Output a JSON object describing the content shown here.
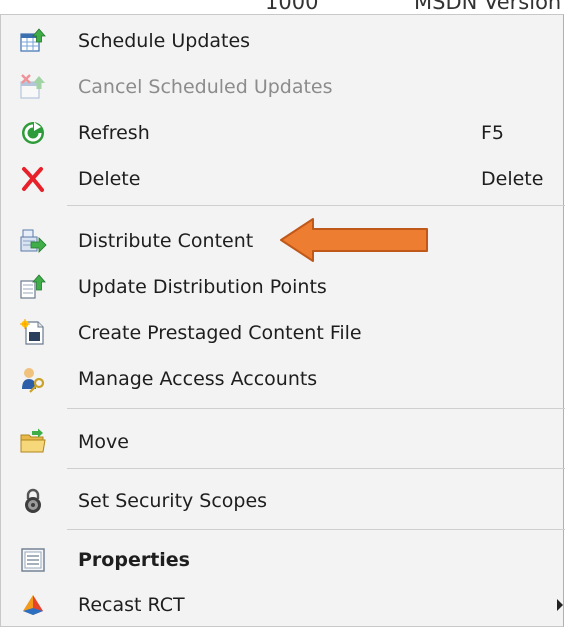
{
  "background": {
    "text_left": "1000",
    "text_right": "MSDN Version"
  },
  "menu": {
    "items": [
      {
        "label": "Schedule Updates",
        "shortcut": "",
        "icon": "schedule-updates-icon",
        "disabled": false
      },
      {
        "label": "Cancel Scheduled Updates",
        "shortcut": "",
        "icon": "cancel-schedule-icon",
        "disabled": true
      },
      {
        "label": "Refresh",
        "shortcut": "F5",
        "icon": "refresh-icon",
        "disabled": false
      },
      {
        "label": "Delete",
        "shortcut": "Delete",
        "icon": "delete-icon",
        "disabled": false
      },
      {
        "label": "Distribute Content",
        "shortcut": "",
        "icon": "distribute-content-icon",
        "disabled": false
      },
      {
        "label": "Update Distribution Points",
        "shortcut": "",
        "icon": "update-distribution-icon",
        "disabled": false
      },
      {
        "label": "Create Prestaged Content File",
        "shortcut": "",
        "icon": "prestaged-file-icon",
        "disabled": false
      },
      {
        "label": "Manage Access Accounts",
        "shortcut": "",
        "icon": "access-accounts-icon",
        "disabled": false
      },
      {
        "label": "Move",
        "shortcut": "",
        "icon": "folder-move-icon",
        "disabled": false
      },
      {
        "label": "Set Security Scopes",
        "shortcut": "",
        "icon": "lock-icon",
        "disabled": false
      },
      {
        "label": "Properties",
        "shortcut": "",
        "icon": "properties-icon",
        "disabled": false,
        "bold": true
      },
      {
        "label": "Recast RCT",
        "shortcut": "",
        "icon": "recast-icon",
        "disabled": false,
        "submenu": true
      }
    ]
  },
  "colors": {
    "annotation_arrow": "#ed7d31",
    "annotation_arrow_border": "#c0581a",
    "delete_red": "#e8202a",
    "refresh_green": "#2e9c3a"
  }
}
